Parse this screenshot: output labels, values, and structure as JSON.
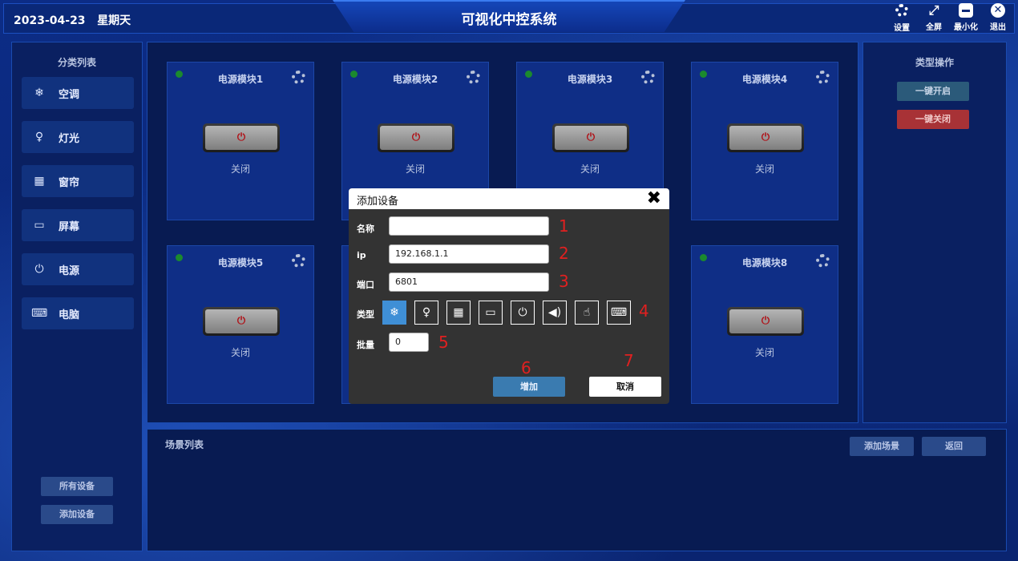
{
  "header": {
    "date": "2023-04-23",
    "weekday": "星期天",
    "title": "可视化中控系统",
    "tools": [
      {
        "label": "设置",
        "icon": "gear-icon"
      },
      {
        "label": "全屏",
        "icon": "fullscreen-icon"
      },
      {
        "label": "最小化",
        "icon": "minimize-icon"
      },
      {
        "label": "退出",
        "icon": "close-circle-icon"
      }
    ]
  },
  "sidebar": {
    "title": "分类列表",
    "items": [
      {
        "label": "空调",
        "icon": "snowflake-icon",
        "glyph": "❄"
      },
      {
        "label": "灯光",
        "icon": "lightbulb-icon",
        "glyph": "♀"
      },
      {
        "label": "窗帘",
        "icon": "grid-icon",
        "glyph": "▦"
      },
      {
        "label": "屏幕",
        "icon": "monitor-icon",
        "glyph": "▭"
      },
      {
        "label": "电源",
        "icon": "power-icon",
        "glyph": "⏻"
      },
      {
        "label": "电脑",
        "icon": "laptop-icon",
        "glyph": "⌨"
      }
    ],
    "all_devices": "所有设备",
    "add_device": "添加设备"
  },
  "devices": [
    {
      "name": "电源模块1",
      "state": "关闭"
    },
    {
      "name": "电源模块2",
      "state": "关闭"
    },
    {
      "name": "电源模块3",
      "state": "关闭"
    },
    {
      "name": "电源模块4",
      "state": "关闭"
    },
    {
      "name": "电源模块5",
      "state": "关闭"
    },
    {
      "name": "电源模块8",
      "state": "关闭"
    }
  ],
  "power_glyph": "⏻",
  "right_panel": {
    "title": "类型操作",
    "open_all": "一键开启",
    "close_all": "一键关闭"
  },
  "scene": {
    "title": "场景列表",
    "add_scene": "添加场景",
    "back": "返回"
  },
  "modal": {
    "title": "添加设备",
    "close_glyph": "✖",
    "name_label": "名称",
    "name_value": "",
    "ip_label": "ip",
    "ip_value": "192.168.1.1",
    "port_label": "端口",
    "port_value": "6801",
    "type_label": "类型",
    "types": [
      {
        "icon": "snowflake-icon",
        "glyph": "❄"
      },
      {
        "icon": "lightbulb-icon",
        "glyph": "♀"
      },
      {
        "icon": "grid-icon",
        "glyph": "▦"
      },
      {
        "icon": "monitor-icon",
        "glyph": "▭"
      },
      {
        "icon": "power-icon",
        "glyph": "⏻"
      },
      {
        "icon": "speaker-icon",
        "glyph": "◀)"
      },
      {
        "icon": "hand-pointer-icon",
        "glyph": "☝"
      },
      {
        "icon": "laptop-icon",
        "glyph": "⌨"
      }
    ],
    "selected_type": "snowflake-icon",
    "batch_label": "批量",
    "batch_value": "0",
    "add_button": "增加",
    "cancel_button": "取消",
    "annotations": [
      "1",
      "2",
      "3",
      "4",
      "5",
      "6",
      "7"
    ]
  },
  "colors": {
    "background": "#0b2a7a",
    "card": "#0f2e86",
    "status_dot": "#1b8a2e",
    "power_red": "#b0141a",
    "add_button": "#3a7bb0",
    "open_button": "#2b5a7a",
    "close_button": "#a83236",
    "annotation_red": "#e02020"
  }
}
